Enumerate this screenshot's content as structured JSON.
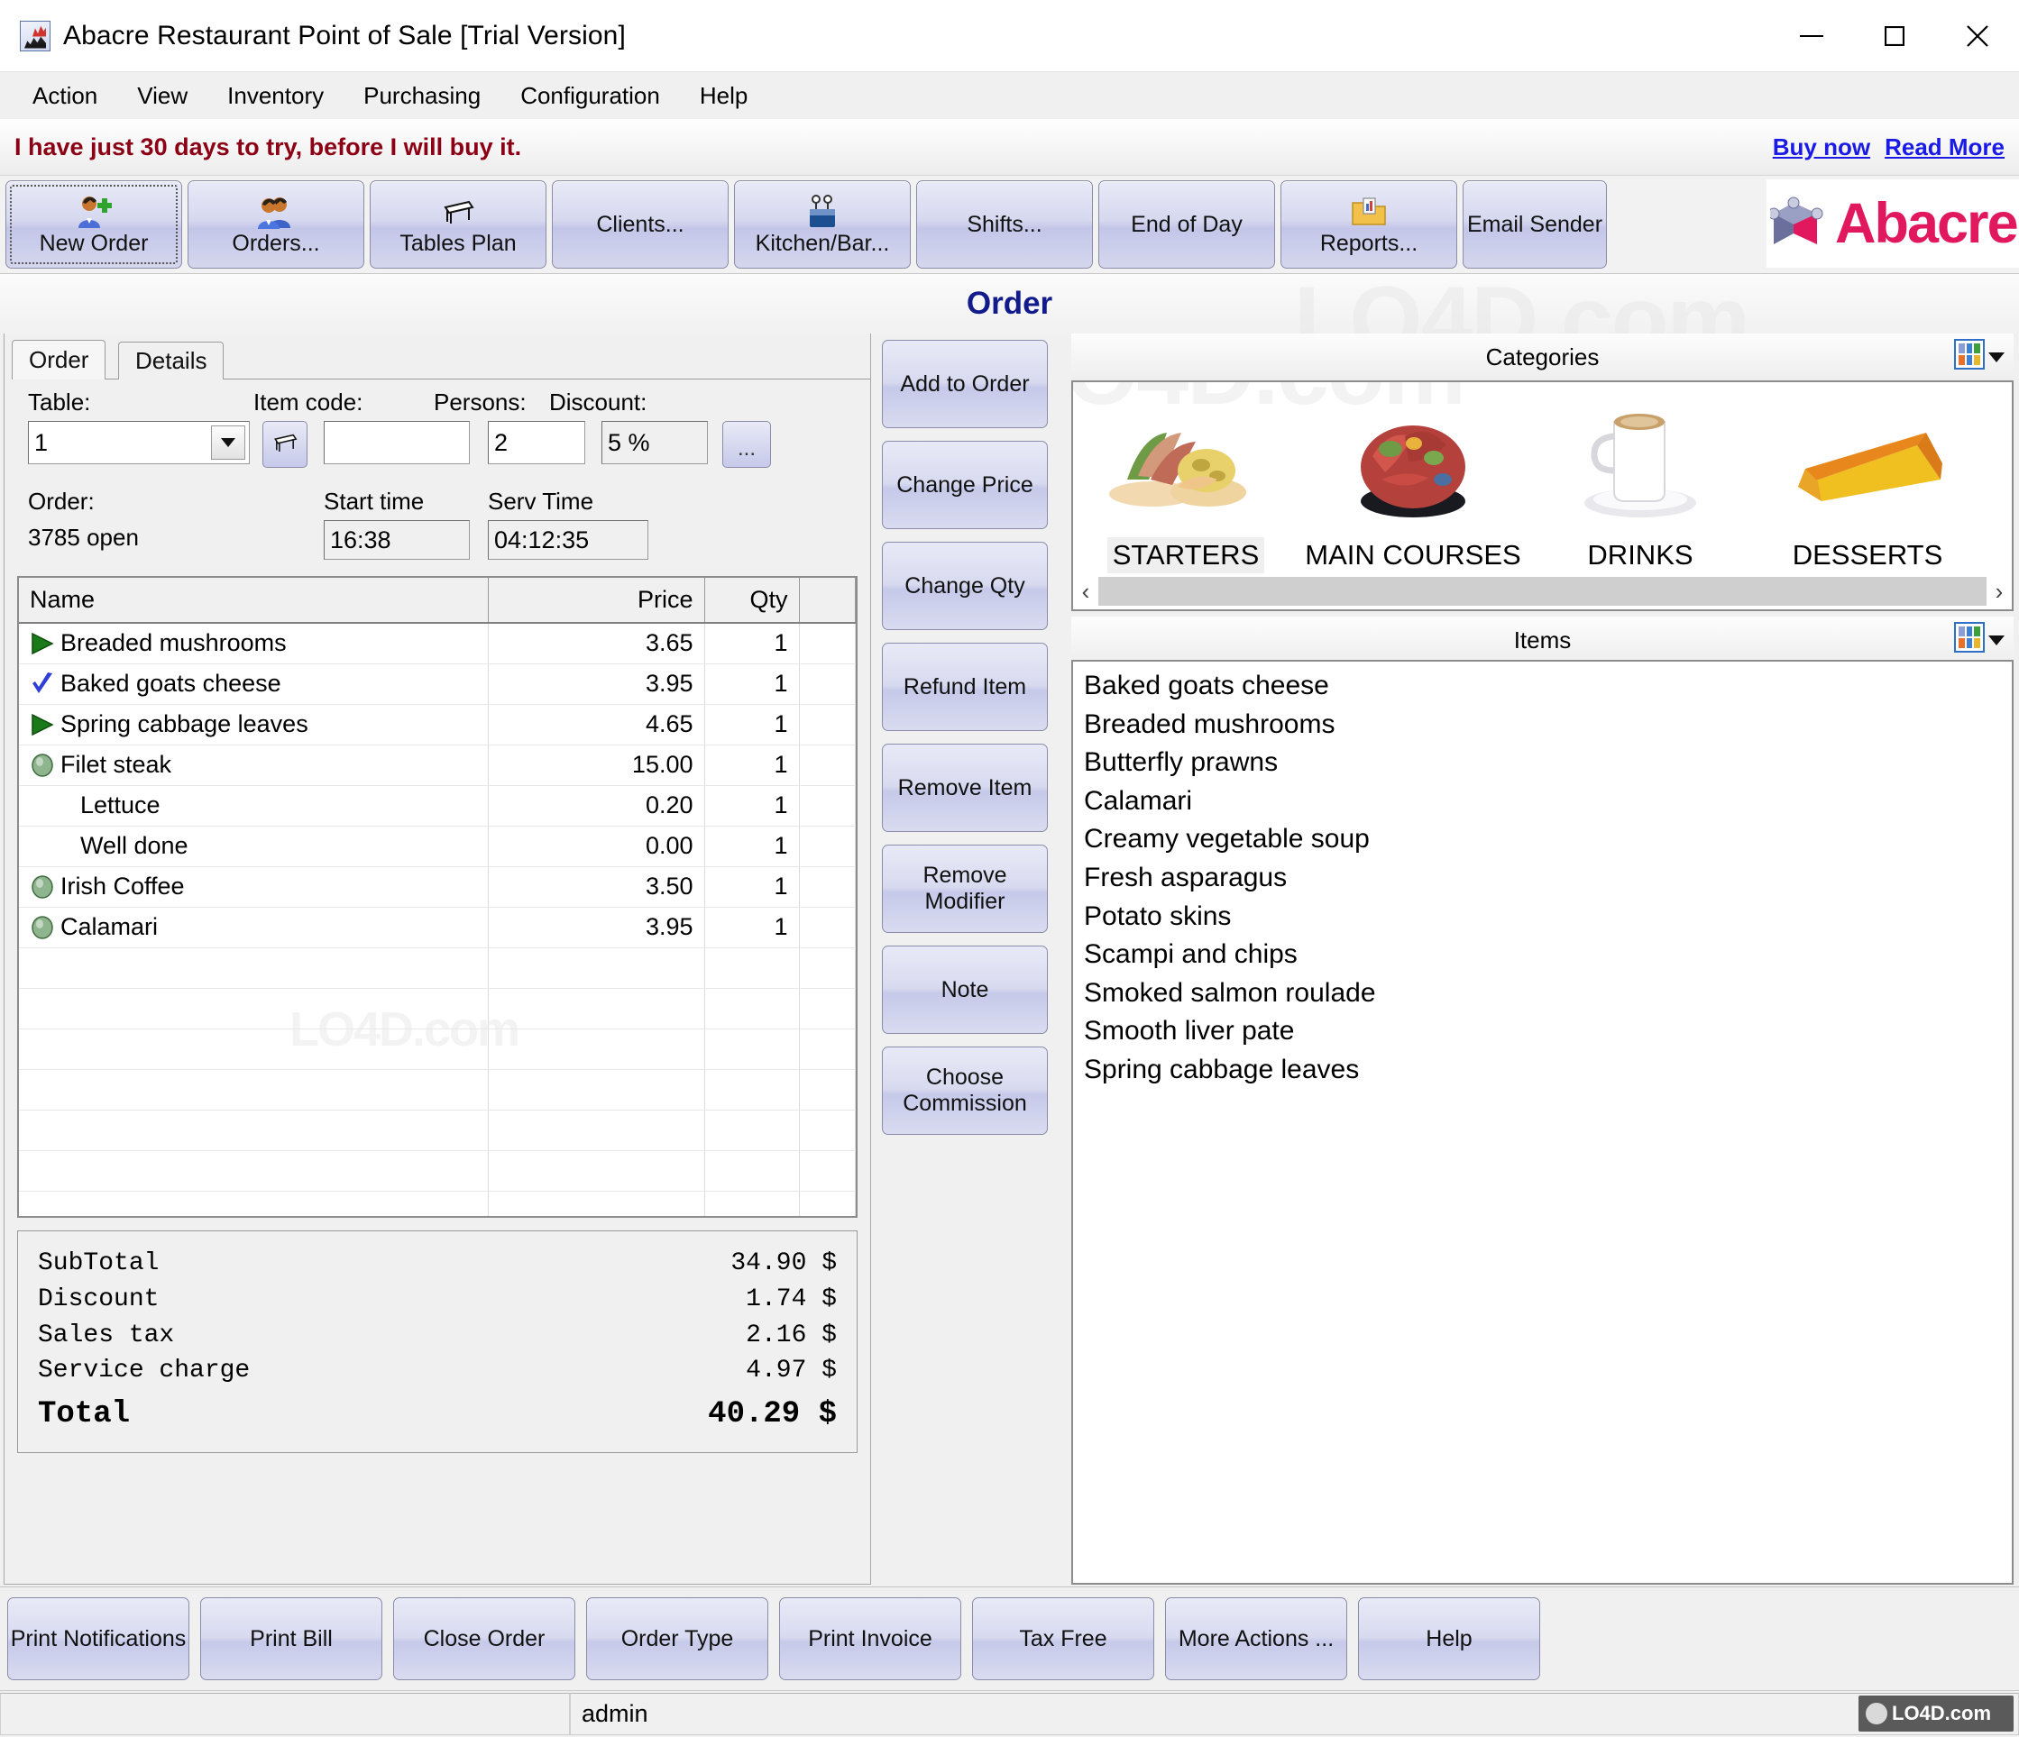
{
  "window": {
    "title": "Abacre Restaurant Point of Sale [Trial Version]",
    "app_icon": "chart-app-icon",
    "controls": {
      "minimize": "minimize-icon",
      "maximize": "maximize-icon",
      "close": "close-icon"
    }
  },
  "menubar": {
    "items": [
      "Action",
      "View",
      "Inventory",
      "Purchasing",
      "Configuration",
      "Help"
    ]
  },
  "trial": {
    "message": "I have just 30 days to try, before I will buy it.",
    "links": [
      "Buy now",
      "Read More"
    ],
    "message_color": "#8b0014",
    "link_color": "#1a1ae6"
  },
  "toolbar": {
    "buttons": [
      {
        "label": "New Order",
        "icon": "user-add-icon",
        "focused": true
      },
      {
        "label": "Orders...",
        "icon": "users-icon",
        "focused": false
      },
      {
        "label": "Tables Plan",
        "icon": "table-icon",
        "focused": false
      },
      {
        "label": "Clients...",
        "icon": "",
        "focused": false
      },
      {
        "label": "Kitchen/Bar...",
        "icon": "kitchen-icon",
        "focused": false
      },
      {
        "label": "Shifts...",
        "icon": "",
        "focused": false
      },
      {
        "label": "End of Day",
        "icon": "",
        "focused": false
      },
      {
        "label": "Reports...",
        "icon": "reports-folder-icon",
        "focused": false
      },
      {
        "label": "Email Sender",
        "icon": "",
        "focused": false
      }
    ],
    "brand": {
      "text": "Abacre",
      "color": "#e2185f",
      "icon": "abacre-cube-logo"
    }
  },
  "page": {
    "title": "Order",
    "title_color": "#111b8c",
    "watermark": "LO4D.com"
  },
  "order_panel": {
    "tabs": [
      {
        "label": "Order",
        "active": true
      },
      {
        "label": "Details",
        "active": false
      }
    ],
    "fields": {
      "table_label": "Table:",
      "table_value": "1",
      "table_plan_icon": "table-icon",
      "item_code_label": "Item code:",
      "item_code_value": "",
      "persons_label": "Persons:",
      "persons_value": "2",
      "discount_label": "Discount:",
      "discount_value": "5 %",
      "discount_more_label": "...",
      "order_label": "Order:",
      "order_value": "3785 open",
      "start_time_label": "Start time",
      "start_time_value": "16:38",
      "serv_time_label": "Serv Time",
      "serv_time_value": "04:12:35"
    },
    "grid": {
      "columns": [
        "Name",
        "Price",
        "Qty"
      ],
      "rows": [
        {
          "icon": "green-triangle-icon",
          "indent": false,
          "name": "Breaded mushrooms",
          "price": "3.65",
          "qty": "1"
        },
        {
          "icon": "blue-check-icon",
          "indent": false,
          "name": "Baked goats cheese",
          "price": "3.95",
          "qty": "1"
        },
        {
          "icon": "green-triangle-icon",
          "indent": false,
          "name": "Spring cabbage leaves",
          "price": "4.65",
          "qty": "1"
        },
        {
          "icon": "green-circle-icon",
          "indent": false,
          "name": "Filet steak",
          "price": "15.00",
          "qty": "1"
        },
        {
          "icon": "none",
          "indent": true,
          "name": "Lettuce",
          "price": "0.20",
          "qty": "1"
        },
        {
          "icon": "none",
          "indent": true,
          "name": "Well done",
          "price": "0.00",
          "qty": "1"
        },
        {
          "icon": "green-circle-icon",
          "indent": false,
          "name": "Irish Coffee",
          "price": "3.50",
          "qty": "1"
        },
        {
          "icon": "green-circle-icon",
          "indent": false,
          "name": "Calamari",
          "price": "3.95",
          "qty": "1"
        }
      ],
      "empty_rows": 9
    },
    "totals": [
      {
        "label": "SubTotal",
        "value": "34.90 $"
      },
      {
        "label": "Discount",
        "value": "1.74 $"
      },
      {
        "label": "Sales tax",
        "value": "2.16 $"
      },
      {
        "label": "Service charge",
        "value": "4.97 $"
      }
    ],
    "grand_total": {
      "label": "Total",
      "value": "40.29 $"
    }
  },
  "action_buttons": [
    "Add to Order",
    "Change Price",
    "Change Qty",
    "Refund Item",
    "Remove Item",
    "Remove\nModifier",
    "Note",
    "Choose\nCommission"
  ],
  "categories_panel": {
    "title": "Categories",
    "view_icon": "grid-view-icon",
    "dropdown_icon": "chevron-down-icon",
    "items": [
      {
        "name": "STARTERS",
        "image": "starters-plate-photo",
        "selected": true
      },
      {
        "name": "MAIN COURSES",
        "image": "main-courses-plate-photo",
        "selected": false
      },
      {
        "name": "DRINKS",
        "image": "coffee-cup-photo",
        "selected": false
      },
      {
        "name": "DESSERTS",
        "image": "cake-slice-photo",
        "selected": false
      }
    ],
    "scroll_left_icon": "chevron-left-icon",
    "scroll_right_icon": "chevron-right-icon"
  },
  "items_panel": {
    "title": "Items",
    "view_icon": "grid-view-icon",
    "dropdown_icon": "chevron-down-icon",
    "items": [
      "Baked goats cheese",
      "Breaded mushrooms",
      "Butterfly prawns",
      "Calamari",
      "Creamy vegetable soup",
      "Fresh asparagus",
      "Potato skins",
      "Scampi and chips",
      "Smoked salmon roulade",
      "Smooth liver pate",
      "Spring cabbage leaves"
    ]
  },
  "bottom_buttons": [
    "Print Notifications",
    "Print Bill",
    "Close Order",
    "Order Type",
    "Print Invoice",
    "Tax Free",
    "More Actions ...",
    "Help"
  ],
  "statusbar": {
    "left": "",
    "user": "admin",
    "watermark": "LO4D.com"
  }
}
